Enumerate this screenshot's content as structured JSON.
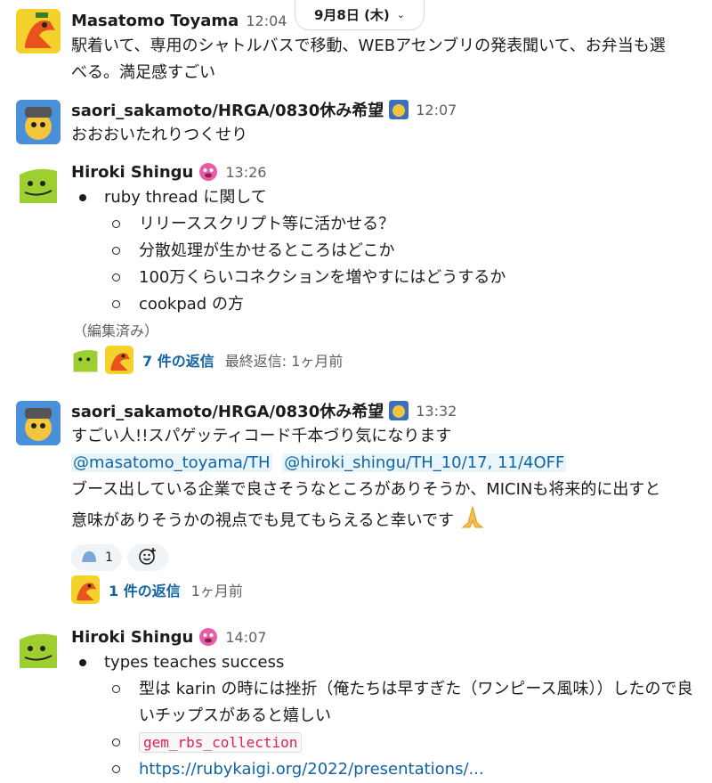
{
  "date_divider": {
    "label": "9月8日 (木)"
  },
  "messages": [
    {
      "author": "Masatomo Toyama",
      "time": "12:04",
      "text_lines": [
        "駅着いて、専用のシャトルバスで移動、WEBアセンブリの発表聞いて、お弁当も選",
        "べる。満足感すごい"
      ]
    },
    {
      "author": "saori_sakamoto/HRGA/0830休み希望",
      "time": "12:07",
      "text": "おおおいたれりつくせり"
    },
    {
      "author": "Hiroki Shingu",
      "time": "13:26",
      "bullet": "ruby thread に関して",
      "sub_bullets": [
        "リリーススクリプト等に活かせる？",
        "分散処理が生かせるところはどこか",
        "100万くらいコネクションを増やすにはどうするか",
        "cookpad  の方"
      ],
      "edited": "（編集済み）",
      "thread": {
        "replies": "7 件の返信",
        "last_reply": "最終返信: 1ヶ月前"
      }
    },
    {
      "author": "saori_sakamoto/HRGA/0830休み希望",
      "time": "13:32",
      "line1": "すごい人!!スパゲッティコード千本づり気になります",
      "mentions": [
        "@masatomo_toyama/TH",
        "@hiroki_shingu/TH_10/17, 11/4OFF"
      ],
      "body_lines": [
        "ブース出している企業で良さそうなところがありそうか、MICINも将来的に出すと",
        "意味がありそうかの視点でも見てもらえると幸いです"
      ],
      "reaction_count": "1",
      "thread": {
        "replies": "1 件の返信",
        "last_reply": "1ヶ月前"
      }
    },
    {
      "author": "Hiroki Shingu",
      "time": "14:07",
      "bullet": "types teaches success",
      "sub_bullets": [
        "型は karin の時には挫折（俺たちは早すぎた（ワンピース風味））したので良いチップスがあると嬉しい",
        "gem_rbs_collection",
        "https://rubykaigi.org/2022/presentations/..."
      ]
    }
  ],
  "colors": {
    "link": "#1264a3",
    "mention_bg": "#e8f5fa",
    "code_red": "#e01e5a",
    "muted": "#616061"
  },
  "icons": [
    "chevron-down-icon",
    "heart-eyes-emoji-icon",
    "pray-emoji-icon",
    "add-reaction-icon",
    "wave-reaction-icon"
  ]
}
